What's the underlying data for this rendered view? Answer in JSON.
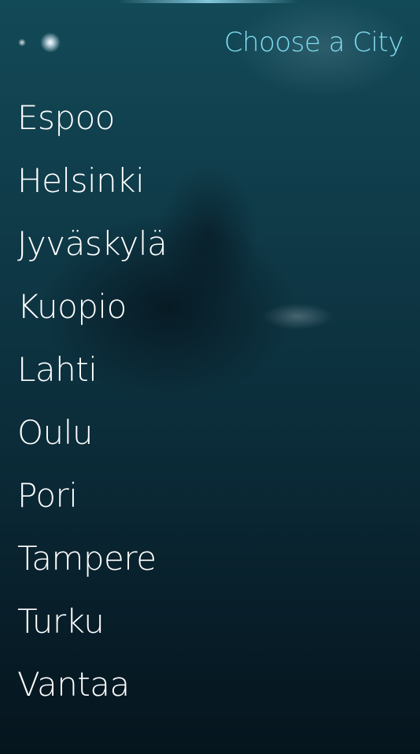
{
  "header": {
    "title": "Choose a City"
  },
  "cities": [
    "Espoo",
    "Helsinki",
    "Jyväskylä",
    "Kuopio",
    "Lahti",
    "Oulu",
    "Pori",
    "Tampere",
    "Turku",
    "Vantaa"
  ],
  "icons": {
    "pulley_menu": "pulley-menu-indicator-icon"
  },
  "colors": {
    "accent": "#7fdcf0",
    "text": "#ffffff",
    "background_top": "#134a58",
    "background_bottom": "#05151e"
  }
}
